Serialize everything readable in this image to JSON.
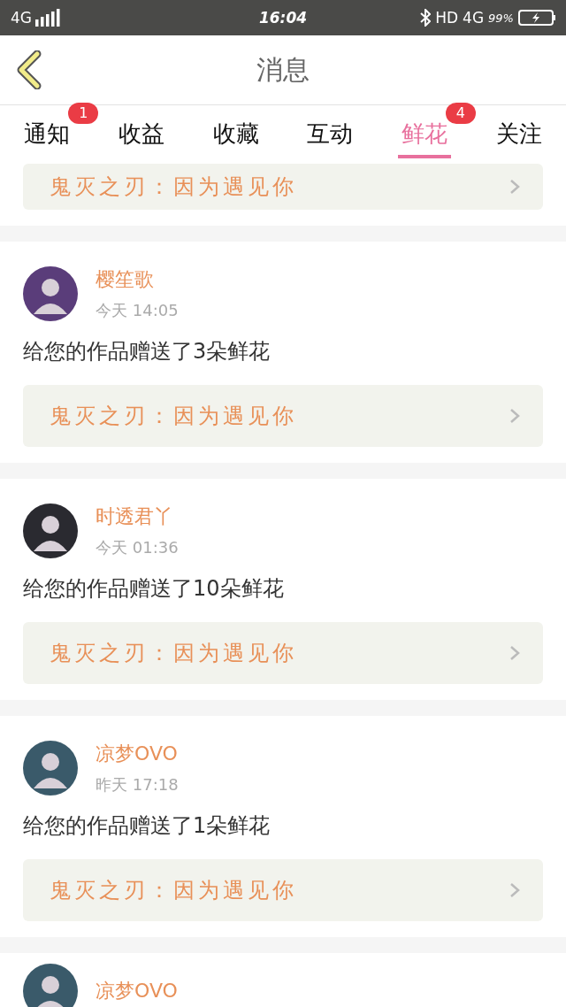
{
  "status_bar": {
    "network": "4G",
    "time": "16:04",
    "hd": "HD",
    "network_right": "4G",
    "battery": "99%"
  },
  "header": {
    "title": "消息"
  },
  "tabs": [
    {
      "label": "通知",
      "selected": false,
      "badge": "1"
    },
    {
      "label": "收益",
      "selected": false
    },
    {
      "label": "收藏",
      "selected": false
    },
    {
      "label": "互动",
      "selected": false
    },
    {
      "label": "鲜花",
      "selected": true,
      "badge": "4"
    },
    {
      "label": "关注",
      "selected": false
    }
  ],
  "messages": [
    {
      "kind": "partial",
      "work": "鬼灭之刃：因为遇见你"
    },
    {
      "kind": "full",
      "user": "樱笙歌",
      "time": "今天 14:05",
      "text": "给您的作品赠送了3朵鲜花",
      "work": "鬼灭之刃：因为遇见你",
      "color": "#5a3d7a"
    },
    {
      "kind": "full",
      "user": "时透君丫",
      "time": "今天 01:36",
      "text": "给您的作品赠送了10朵鲜花",
      "work": "鬼灭之刃：因为遇见你",
      "color": "#2a2a30"
    },
    {
      "kind": "full",
      "user": "凉梦OVO",
      "time": "昨天 17:18",
      "text": "给您的作品赠送了1朵鲜花",
      "work": "鬼灭之刃：因为遇见你",
      "color": "#3a5a6a"
    },
    {
      "kind": "head",
      "user": "凉梦OVO",
      "color": "#3a5a6a"
    }
  ]
}
